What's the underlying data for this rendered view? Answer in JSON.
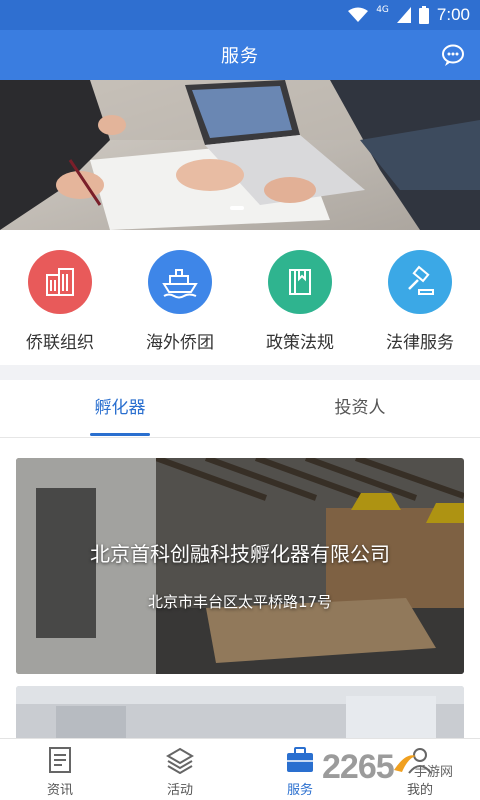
{
  "status_bar": {
    "network": "4G",
    "time": "7:00"
  },
  "header": {
    "title": "服务"
  },
  "quick_menu": [
    {
      "label": "侨联组织",
      "color": "#e85a5a"
    },
    {
      "label": "海外侨团",
      "color": "#3e86e8"
    },
    {
      "label": "政策法规",
      "color": "#2fb48f"
    },
    {
      "label": "法律服务",
      "color": "#3ba8e6"
    }
  ],
  "tabs": [
    {
      "label": "孵化器",
      "active": true
    },
    {
      "label": "投资人",
      "active": false
    }
  ],
  "cards": [
    {
      "title": "北京首科创融科技孵化器有限公司",
      "address": "北京市丰台区太平桥路17号"
    }
  ],
  "bottom_nav": [
    {
      "label": "资讯",
      "active": false
    },
    {
      "label": "活动",
      "active": false
    },
    {
      "label": "服务",
      "active": true
    },
    {
      "label": "我的",
      "active": false
    }
  ],
  "watermark": {
    "number": "2265",
    "text": "手游网"
  },
  "colors": {
    "primary": "#3a7de0",
    "accent": "#2a6fcf"
  }
}
